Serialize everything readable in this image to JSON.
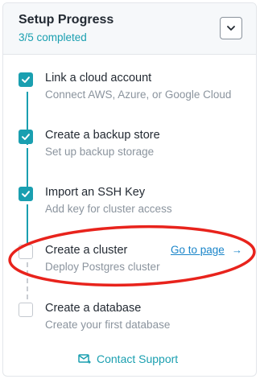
{
  "header": {
    "title": "Setup Progress",
    "progress": "3/5 completed"
  },
  "steps": [
    {
      "title": "Link a cloud account",
      "description": "Connect AWS, Azure, or Google Cloud",
      "completed": true
    },
    {
      "title": "Create a backup store",
      "description": "Set up backup storage",
      "completed": true
    },
    {
      "title": "Import an SSH Key",
      "description": "Add key for cluster access",
      "completed": true
    },
    {
      "title": "Create a cluster",
      "description": "Deploy Postgres cluster",
      "completed": false,
      "action": "Go to page"
    },
    {
      "title": "Create a database",
      "description": "Create your first database",
      "completed": false
    }
  ],
  "footer": {
    "support_label": "Contact Support"
  },
  "colors": {
    "accent": "#1a9fb0",
    "link": "#1a85c9",
    "annotation": "#e8231c"
  },
  "icons": {
    "collapse": "chevron-down-icon",
    "check": "check-icon",
    "arrow": "arrow-right-icon",
    "support": "mail-icon"
  }
}
